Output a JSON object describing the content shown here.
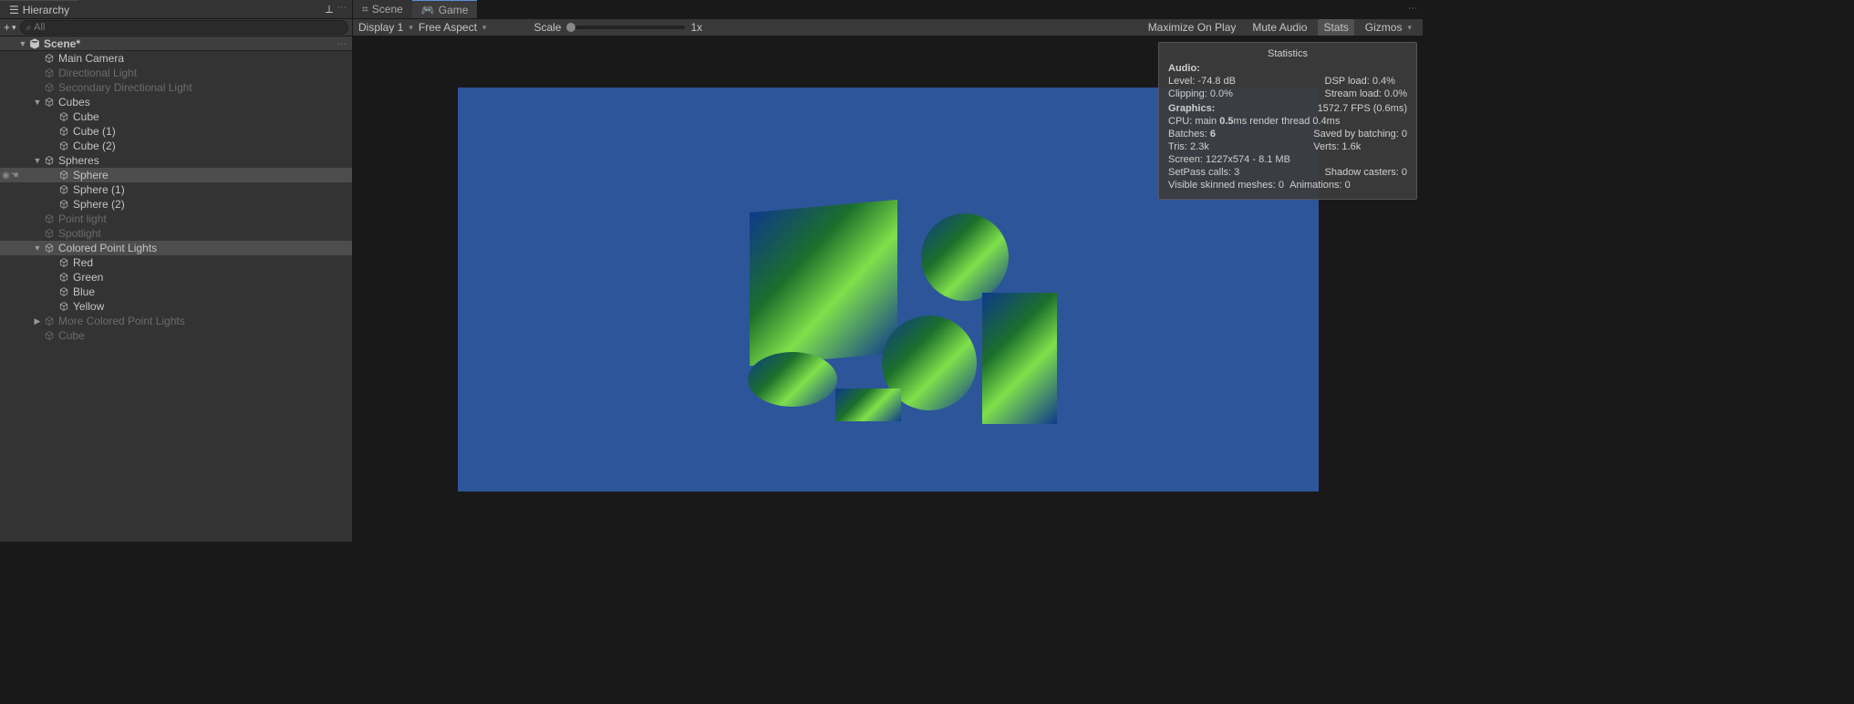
{
  "hierarchy": {
    "tab_label": "Hierarchy",
    "search_placeholder": "All",
    "scene_label": "Scene*",
    "items": [
      {
        "label": "Main Camera",
        "indent": 2,
        "dim": false
      },
      {
        "label": "Directional Light",
        "indent": 2,
        "dim": true
      },
      {
        "label": "Secondary Directional Light",
        "indent": 2,
        "dim": true
      },
      {
        "label": "Cubes",
        "indent": 2,
        "fold": "expanded"
      },
      {
        "label": "Cube",
        "indent": 3
      },
      {
        "label": "Cube (1)",
        "indent": 3
      },
      {
        "label": "Cube (2)",
        "indent": 3
      },
      {
        "label": "Spheres",
        "indent": 2,
        "fold": "expanded"
      },
      {
        "label": "Sphere",
        "indent": 3,
        "highlight": true
      },
      {
        "label": "Sphere (1)",
        "indent": 3
      },
      {
        "label": "Sphere (2)",
        "indent": 3
      },
      {
        "label": "Point light",
        "indent": 2,
        "dim": true
      },
      {
        "label": "Spotlight",
        "indent": 2,
        "dim": true
      },
      {
        "label": "Colored Point Lights",
        "indent": 2,
        "fold": "expanded",
        "highlight": true
      },
      {
        "label": "Red",
        "indent": 3
      },
      {
        "label": "Green",
        "indent": 3
      },
      {
        "label": "Blue",
        "indent": 3
      },
      {
        "label": "Yellow",
        "indent": 3
      },
      {
        "label": "More Colored Point Lights",
        "indent": 2,
        "dim": true,
        "fold": "collapsed"
      },
      {
        "label": "Cube",
        "indent": 2,
        "dim": true
      }
    ]
  },
  "game": {
    "scene_tab": "Scene",
    "game_tab": "Game",
    "display": "Display 1",
    "aspect": "Free Aspect",
    "scale_label": "Scale",
    "scale_value": "1x",
    "maximize": "Maximize On Play",
    "mute": "Mute Audio",
    "stats_btn": "Stats",
    "gizmos": "Gizmos"
  },
  "stats": {
    "title": "Statistics",
    "audio_heading": "Audio:",
    "audio_level": "Level: -74.8 dB",
    "audio_clipping": "Clipping: 0.0%",
    "audio_dsp": "DSP load: 0.4%",
    "audio_stream": "Stream load: 0.0%",
    "graphics_heading": "Graphics:",
    "fps": "1572.7 FPS (0.6ms)",
    "cpu_pre": "CPU: main ",
    "cpu_bold": "0.5",
    "cpu_post": "ms  render thread 0.4ms",
    "batches_pre": "Batches: ",
    "batches_bold": "6",
    "saved_batching": "Saved by batching: 0",
    "tris": "Tris: 2.3k",
    "verts": "Verts: 1.6k",
    "screen": "Screen: 1227x574 - 8.1 MB",
    "setpass": "SetPass calls: 3",
    "shadow": "Shadow casters: 0",
    "skinned": "Visible skinned meshes: 0",
    "anim": "Animations: 0"
  }
}
